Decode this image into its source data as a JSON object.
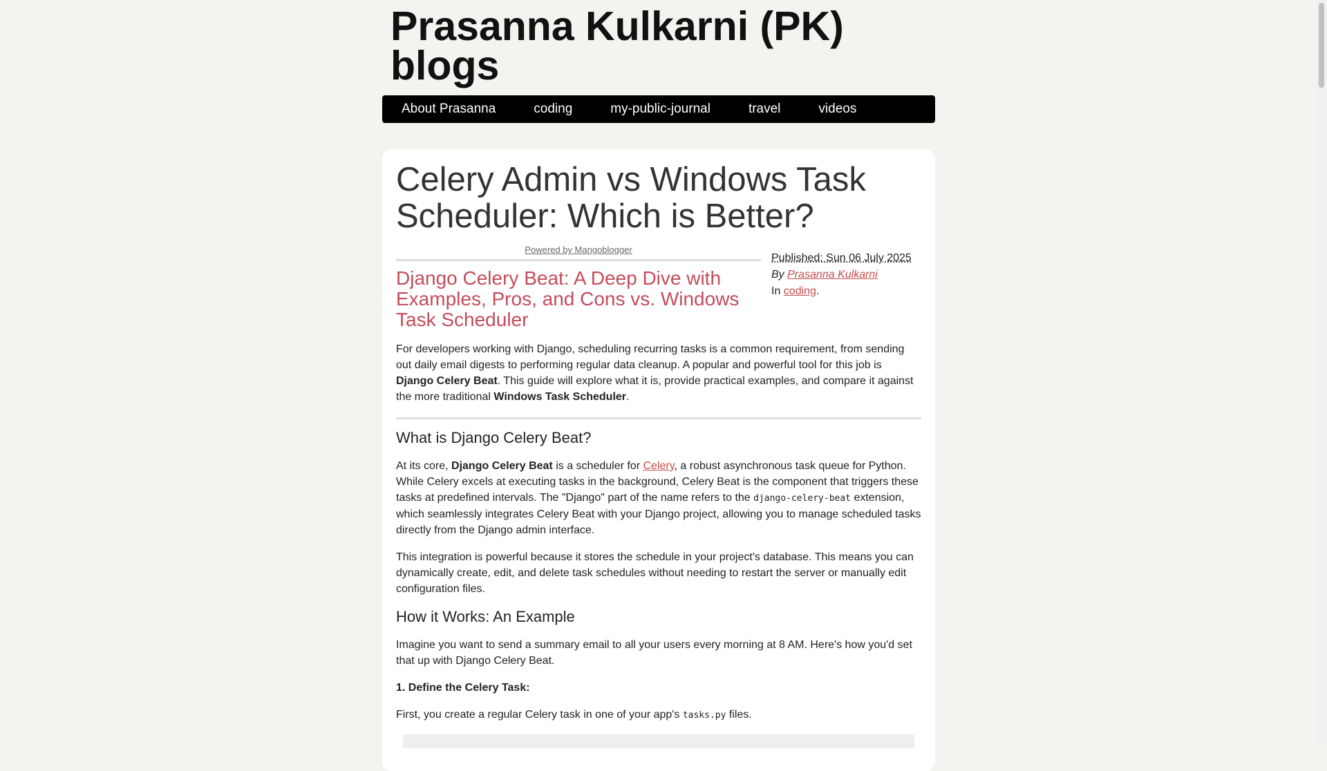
{
  "site": {
    "title": "Prasanna Kulkarni (PK) blogs"
  },
  "nav": [
    {
      "label": "About Prasanna"
    },
    {
      "label": "coding"
    },
    {
      "label": "my-public-journal"
    },
    {
      "label": "travel"
    },
    {
      "label": "videos"
    }
  ],
  "post": {
    "title": "Celery Admin vs Windows Task Scheduler: Which is Better?",
    "powered_by": "Powered by Mangoblogger",
    "published": "Published: Sun 06 July 2025",
    "by_label": "By",
    "author": "Prasanna Kulkarni",
    "in_label": "In",
    "category": "coding",
    "subtitle": "Django Celery Beat: A Deep Dive with Examples, Pros, and Cons vs. Windows Task Scheduler",
    "intro": {
      "a": "For developers working with Django, scheduling recurring tasks is a common requirement, from sending out daily email digests to performing regular data cleanup. A popular and powerful tool for this job is ",
      "b": "Django Celery Beat",
      "c": ". This guide will explore what it is, provide practical examples, and compare it against the more traditional ",
      "d": "Windows Task Scheduler",
      "e": "."
    },
    "h_what": "What is Django Celery Beat?",
    "what_p1": {
      "a": "At its core, ",
      "b": "Django Celery Beat",
      "c": " is a scheduler for ",
      "link": "Celery",
      "d": ", a robust asynchronous task queue for Python. While Celery excels at executing tasks in the background, Celery Beat is the component that triggers these tasks at predefined intervals. The \"Django\" part of the name refers to the ",
      "code": "django-celery-beat",
      "e": " extension, which seamlessly integrates Celery Beat with your Django project, allowing you to manage scheduled tasks directly from the Django admin interface."
    },
    "what_p2": "This integration is powerful because it stores the schedule in your project's database. This means you can dynamically create, edit, and delete task schedules without needing to restart the server or manually edit configuration files.",
    "h_how": "How it Works: An Example",
    "how_p1": "Imagine you want to send a summary email to all your users every morning at 8 AM. Here's how you'd set that up with Django Celery Beat.",
    "step1": "1. Define the Celery Task:",
    "step1_p": {
      "a": "First, you create a regular Celery task in one of your app's ",
      "code": "tasks.py",
      "b": " files."
    }
  }
}
